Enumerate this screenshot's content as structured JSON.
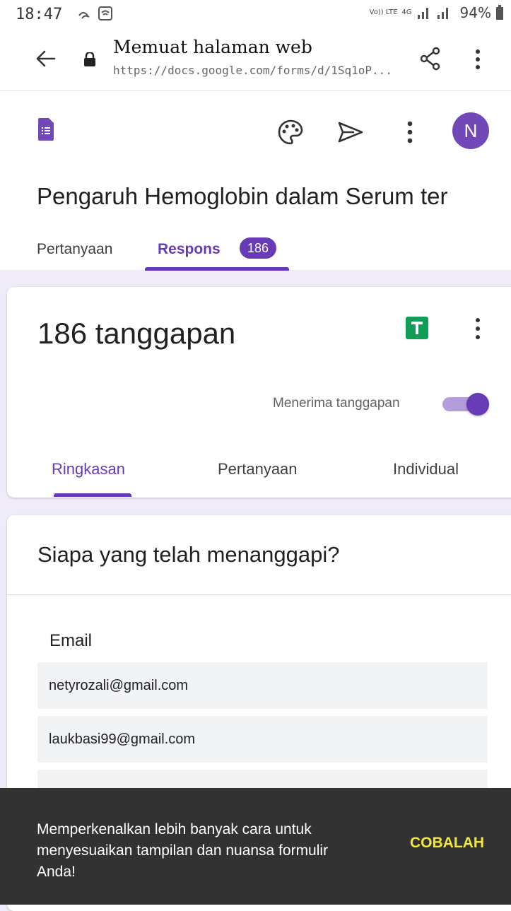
{
  "status_bar": {
    "time": "18:47",
    "battery": "94%",
    "network_labels": [
      "Vo)) LTE",
      "4G"
    ]
  },
  "browser": {
    "page_title": "Memuat halaman web",
    "url": "https://docs.google.com/forms/d/1Sq1oP..."
  },
  "form": {
    "title": "Pengaruh Hemoglobin dalam Serum ter",
    "avatar_letter": "N",
    "tabs": [
      {
        "label": "Pertanyaan"
      },
      {
        "label": "Respons",
        "badge": "186",
        "active": true
      }
    ]
  },
  "summary": {
    "response_count": "186 tanggapan",
    "accepting_label": "Menerima tanggapan",
    "accepting": true,
    "subtabs": [
      {
        "label": "Ringkasan",
        "active": true
      },
      {
        "label": "Pertanyaan"
      },
      {
        "label": "Individual"
      }
    ]
  },
  "responders": {
    "title": "Siapa yang telah menanggapi?",
    "column_header": "Email",
    "emails": [
      "netyrozali@gmail.com",
      "laukbasi99@gmail.com",
      ""
    ]
  },
  "snackbar": {
    "message": "Memperkenalkan lebih banyak cara untuk menyesuaikan tampilan dan nuansa formulir Anda!",
    "action": "COBALAH"
  },
  "colors": {
    "accent": "#673ab7",
    "background": "#f0ebf8",
    "snackbar": "#323232",
    "snackbar_action": "#f1e83c",
    "sheets_green": "#0f9d58"
  },
  "icons": [
    "back-arrow-icon",
    "lock-icon",
    "share-icon",
    "more-vert-icon",
    "forms-logo-icon",
    "palette-icon",
    "send-icon",
    "sheets-icon"
  ]
}
